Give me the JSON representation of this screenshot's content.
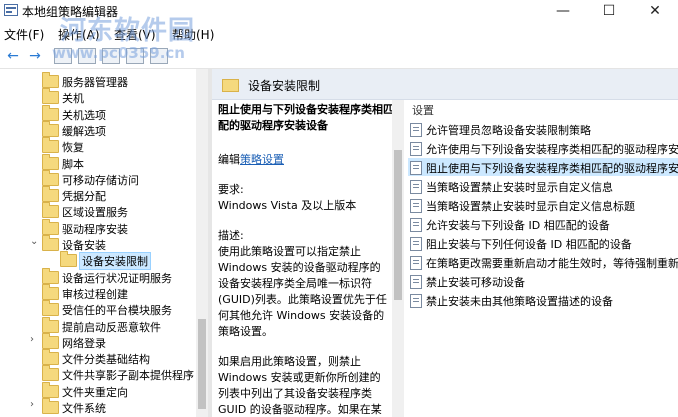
{
  "window": {
    "title": "本地组策略编辑器",
    "minimize": "—",
    "maximize": "☐",
    "close": "✕"
  },
  "menubar": {
    "file": "文件(F)",
    "action": "操作(A)",
    "view": "查看(V)",
    "help": "帮助(H)"
  },
  "watermark": {
    "name": "河东软件园",
    "url": "www.pc0359.cn"
  },
  "tree": {
    "items": [
      {
        "label": "服务器管理器",
        "expanded": false,
        "level": 0
      },
      {
        "label": "关机",
        "expanded": false,
        "level": 0
      },
      {
        "label": "关机选项",
        "expanded": false,
        "level": 0
      },
      {
        "label": "缓解选项",
        "expanded": false,
        "level": 0
      },
      {
        "label": "恢复",
        "expanded": false,
        "level": 0
      },
      {
        "label": "脚本",
        "expanded": false,
        "level": 0
      },
      {
        "label": "可移动存储访问",
        "expanded": false,
        "level": 0
      },
      {
        "label": "凭据分配",
        "expanded": false,
        "level": 0
      },
      {
        "label": "区域设置服务",
        "expanded": false,
        "level": 0
      },
      {
        "label": "驱动程序安装",
        "expanded": false,
        "level": 0
      },
      {
        "label": "设备安装",
        "expanded": true,
        "level": 0
      },
      {
        "label": "设备安装限制",
        "expanded": false,
        "level": 1,
        "selected": true
      },
      {
        "label": "设备运行状况证明服务",
        "expanded": false,
        "level": 0
      },
      {
        "label": "审核过程创建",
        "expanded": false,
        "level": 0
      },
      {
        "label": "受信任的平台模块服务",
        "expanded": false,
        "level": 0
      },
      {
        "label": "提前启动反恶意软件",
        "expanded": false,
        "level": 0
      },
      {
        "label": "网络登录",
        "expanded": false,
        "level": 0,
        "hasChildren": true
      },
      {
        "label": "文件分类基础结构",
        "expanded": false,
        "level": 0
      },
      {
        "label": "文件共享影子副本提供程序",
        "expanded": false,
        "level": 0
      },
      {
        "label": "文件夹重定向",
        "expanded": false,
        "level": 0
      },
      {
        "label": "文件系统",
        "expanded": false,
        "level": 0,
        "hasChildren": true
      }
    ]
  },
  "right": {
    "header": "设备安装限制",
    "description": {
      "title": "阻止使用与下列设备安装程序类相匹配的驱动程序安装设备",
      "edit_prefix": "编辑",
      "edit_link": "策略设置",
      "requirement_label": "要求:",
      "requirement_value": "Windows Vista 及以上版本",
      "desc_label": "描述:",
      "desc_text": "使用此策略设置可以指定禁止 Windows 安装的设备驱动程序的设备安装程序类全局唯一标识符(GUID)列表。此策略设置优先于任何其他允许 Windows 安装设备的策略设置。",
      "desc_text2": "如果启用此策略设置，则禁止 Windows 安装或更新你所创建的列表中列出了其设备安装程序类 GUID 的设备驱动程序。如果在某"
    },
    "list_header": "设置",
    "settings": [
      "允许管理员忽略设备安装限制策略",
      "允许使用与下列设备安装程序类相匹配的驱动程序安",
      "阻止使用与下列设备安装程序类相匹配的驱动程序安",
      "当策略设置禁止安装时显示自定义信息",
      "当策略设置禁止安装时显示自定义信息标题",
      "允许安装与下列设备 ID 相匹配的设备",
      "阻止安装与下列任何设备 ID 相匹配的设备",
      "在策略更改需要重新启动才能生效时，等待强制重新",
      "禁止安装可移动设备",
      "禁止安装未由其他策略设置描述的设备"
    ],
    "selected_index": 2
  }
}
